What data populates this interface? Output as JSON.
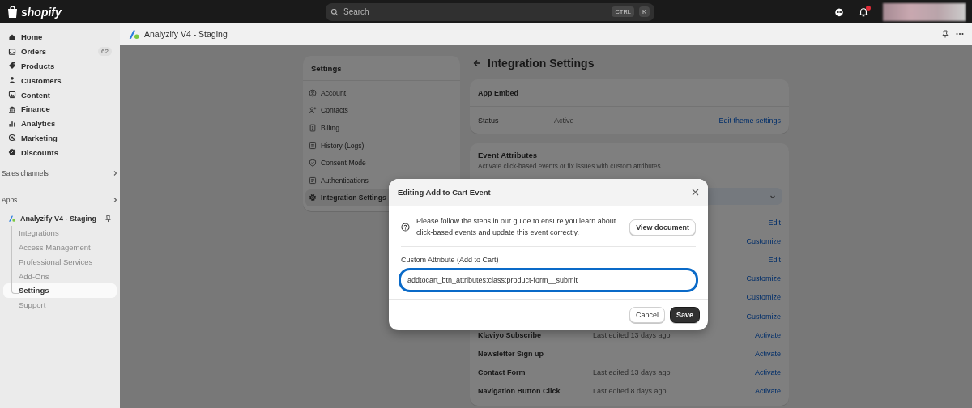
{
  "topbar": {
    "logo": "shopify",
    "search": {
      "placeholder": "Search",
      "keys": [
        "CTRL",
        "K"
      ]
    }
  },
  "app_header": {
    "title": "Analyzify V4 - Staging"
  },
  "sidebar": {
    "items": [
      {
        "label": "Home",
        "selected": false
      },
      {
        "label": "Orders",
        "badge": "62",
        "selected": false
      },
      {
        "label": "Products",
        "selected": false
      },
      {
        "label": "Customers",
        "selected": false
      },
      {
        "label": "Content",
        "selected": false
      },
      {
        "label": "Finance",
        "selected": false
      },
      {
        "label": "Analytics",
        "selected": false
      },
      {
        "label": "Marketing",
        "selected": false
      },
      {
        "label": "Discounts",
        "selected": false
      }
    ],
    "sections": [
      {
        "label": "Sales channels"
      },
      {
        "label": "Apps"
      }
    ],
    "app": {
      "label": "Analyzify V4 - Staging",
      "children": [
        {
          "label": "Integrations",
          "selected": false
        },
        {
          "label": "Access Management",
          "selected": false
        },
        {
          "label": "Professional Services",
          "selected": false
        },
        {
          "label": "Add-Ons",
          "selected": false
        },
        {
          "label": "Settings",
          "selected": true
        },
        {
          "label": "Support",
          "selected": false
        }
      ]
    }
  },
  "settings_menu": {
    "title": "Settings",
    "items": [
      {
        "label": "Account",
        "selected": false
      },
      {
        "label": "Contacts",
        "selected": false
      },
      {
        "label": "Billing",
        "selected": false
      },
      {
        "label": "History (Logs)",
        "selected": false
      },
      {
        "label": "Consent Mode",
        "selected": false
      },
      {
        "label": "Authentications",
        "selected": false
      },
      {
        "label": "Integration Settings",
        "selected": true
      }
    ]
  },
  "page": {
    "title": "Integration Settings",
    "app_embed": {
      "title": "App Embed",
      "status_label": "Status",
      "status": "Active",
      "link": "Edit theme settings"
    },
    "event_attributes": {
      "title": "Event Attributes",
      "subtitle": "Activate click-based events or fix issues with custom attributes.",
      "rows": [
        {
          "action": "Edit"
        },
        {
          "action": "Customize"
        },
        {
          "action": "Edit"
        },
        {
          "action": "Customize"
        },
        {
          "action": "Customize"
        },
        {
          "action": "Customize"
        },
        {
          "name": "Klaviyo Subscribe",
          "edited": "Last edited 13 days ago",
          "action": "Activate"
        },
        {
          "name": "Newsletter Sign up",
          "action": "Activate"
        },
        {
          "name": "Contact Form",
          "edited": "Last edited 13 days ago",
          "action": "Activate"
        },
        {
          "name": "Navigation Button Click",
          "edited": "Last edited 8 days ago",
          "action": "Activate"
        }
      ]
    }
  },
  "modal": {
    "title": "Editing Add to Cart Event",
    "info": "Please follow the steps in our guide to ensure you learn about click-based events and update this event correctly.",
    "doc_button": "View document",
    "field": {
      "label": "Custom Attribute (Add to Cart)",
      "value": "addtocart_btn_attributes:class:product-form__submit",
      "focused": true
    },
    "buttons": [
      {
        "label": "Cancel",
        "kind": "secondary"
      },
      {
        "label": "Save",
        "kind": "primary"
      }
    ]
  }
}
